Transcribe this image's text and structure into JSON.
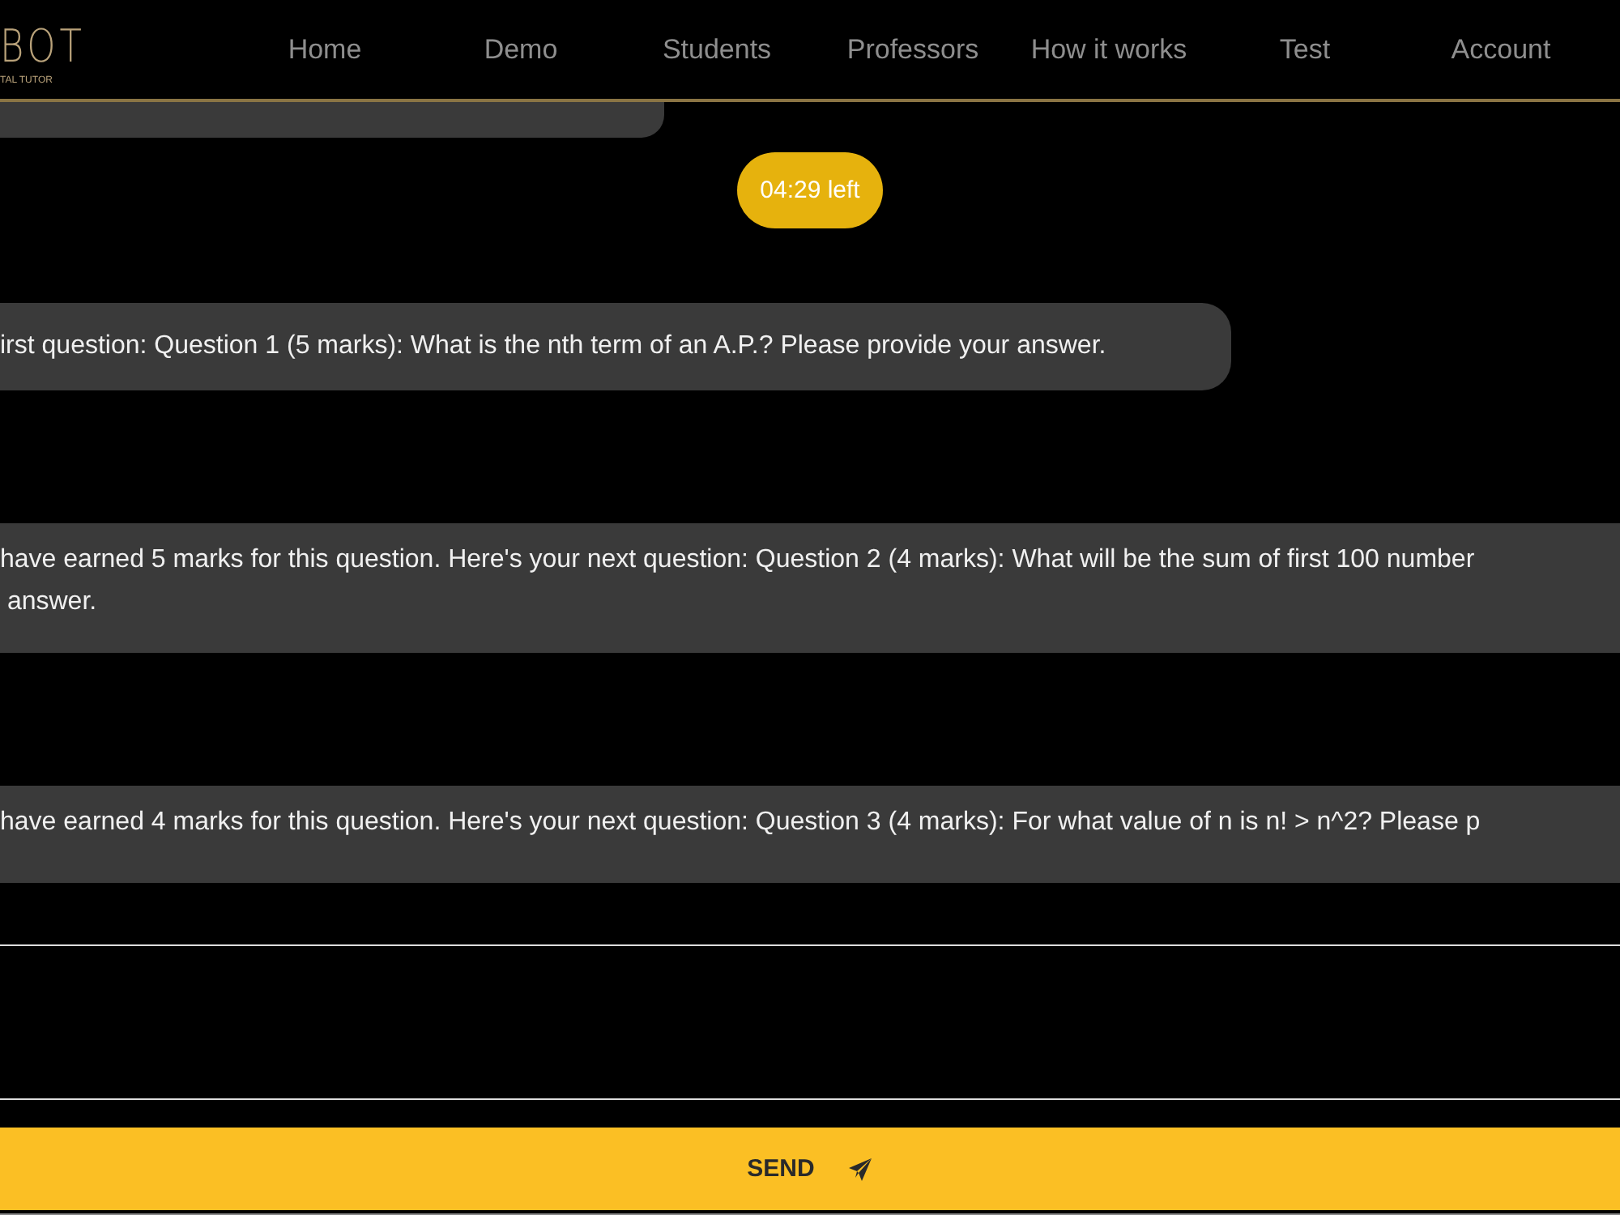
{
  "header": {
    "logo": "BOT",
    "logo_tagline": "TAL TUTOR",
    "nav": [
      {
        "label": "Home"
      },
      {
        "label": "Demo"
      },
      {
        "label": "Students"
      },
      {
        "label": "Professors"
      },
      {
        "label": "How it works"
      },
      {
        "label": "Test"
      },
      {
        "label": "Account"
      }
    ]
  },
  "timer": "04:29 left",
  "messages": [
    {
      "lines": [
        "irst question: Question 1 (5 marks): What is the nth term of an A.P.? Please provide your answer."
      ],
      "wide": false
    },
    {
      "lines": [
        "have earned 5 marks for this question. Here's your next question: Question 2 (4 marks): What will be the sum of first 100 number",
        "answer."
      ],
      "wide": true
    },
    {
      "lines": [
        "have earned 4 marks for this question. Here's your next question: Question 3 (4 marks): For what value of n is n! > n^2? Please p"
      ],
      "wide": true
    }
  ],
  "send_button": "SEND"
}
